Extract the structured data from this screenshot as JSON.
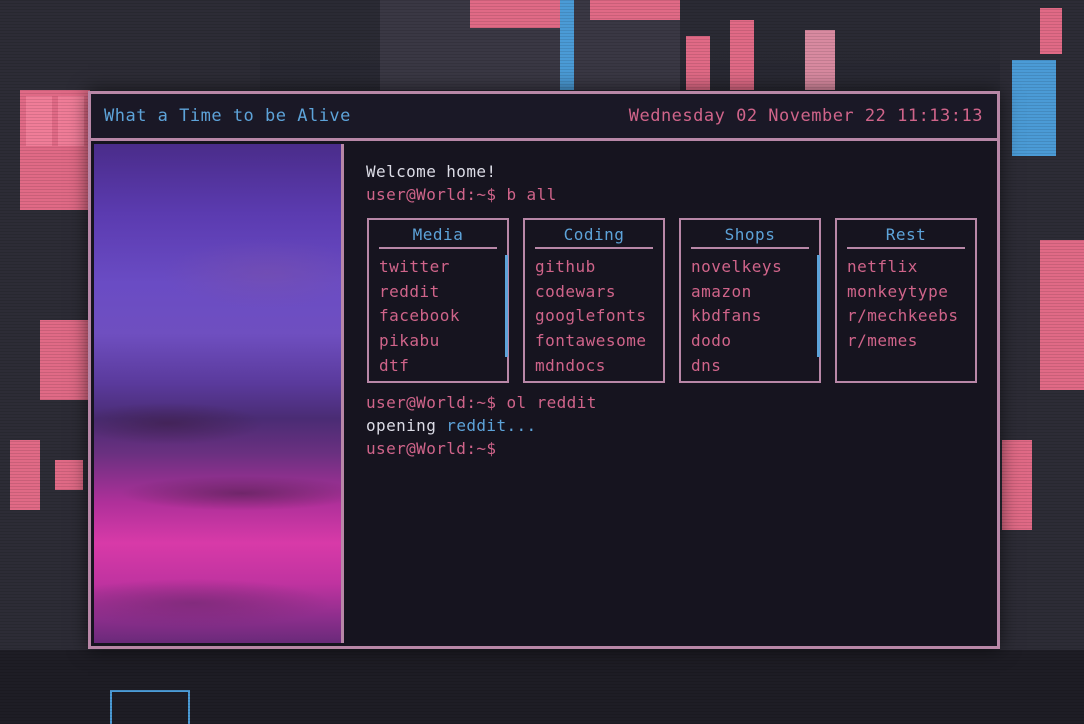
{
  "window": {
    "title": "What a Time to be Alive",
    "datetime": "Wednesday 02 November 22 11:13:13"
  },
  "terminal": {
    "greeting": "Welcome home!",
    "prompt1": "user@World:~$",
    "cmd1": "b all",
    "prompt2": "user@World:~$",
    "cmd2": "ol reddit",
    "opening_word": "opening",
    "opening_target": "reddit...",
    "prompt3": "user@World:~$"
  },
  "categories": [
    {
      "title": "Media",
      "items": [
        "twitter",
        "reddit",
        "facebook",
        "pikabu",
        "dtf"
      ]
    },
    {
      "title": "Coding",
      "items": [
        "github",
        "codewars",
        "googlefonts",
        "fontawesome",
        "mdndocs"
      ]
    },
    {
      "title": "Shops",
      "items": [
        "novelkeys",
        "amazon",
        "kbdfans",
        "dodo",
        "dns"
      ]
    },
    {
      "title": "Rest",
      "items": [
        "netflix",
        "monkeytype",
        "r/mechkeebs",
        "r/memes"
      ]
    }
  ],
  "colors": {
    "accent_blue": "#5da3d9",
    "accent_pink": "#d0648a",
    "border": "#b887a7",
    "background": "#16141f"
  }
}
